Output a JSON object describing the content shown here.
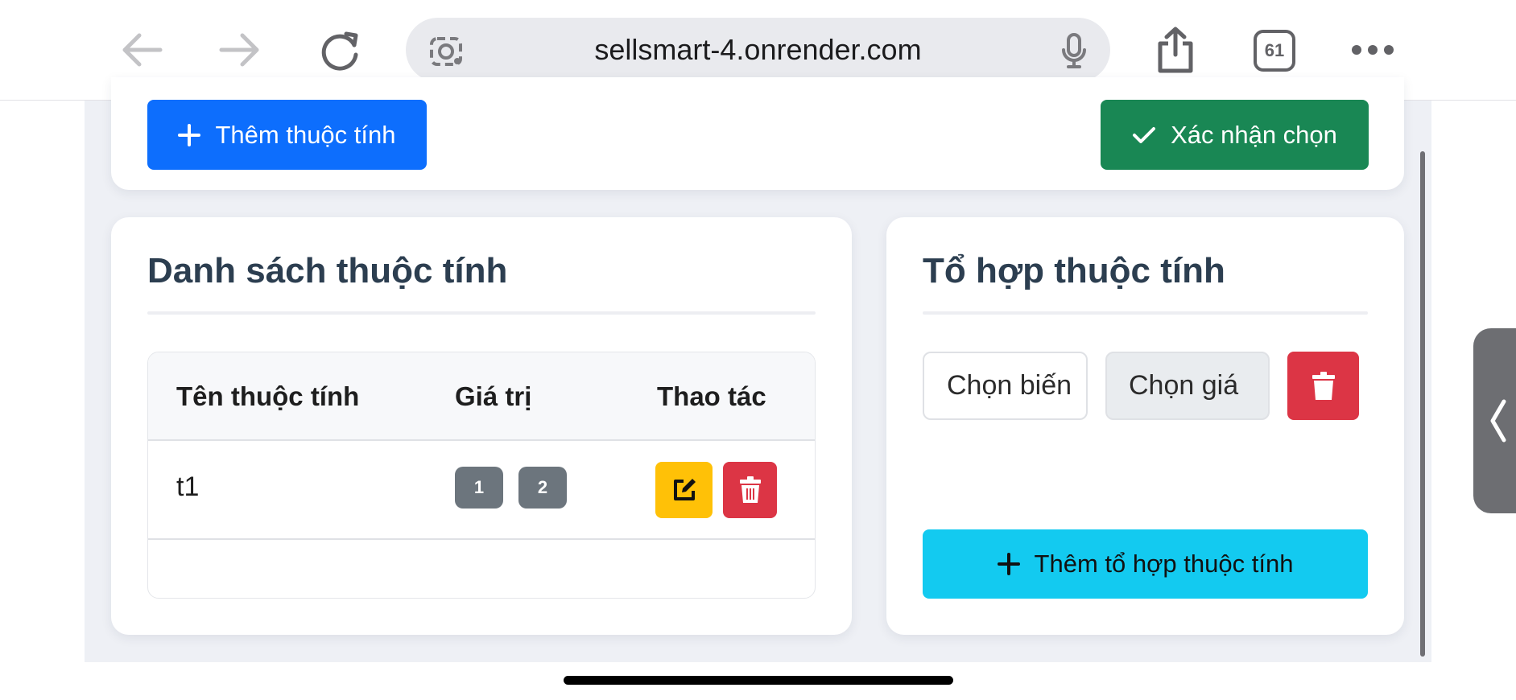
{
  "browser": {
    "url": "sellsmart-4.onrender.com",
    "tab_count": "61",
    "icons": [
      "back-arrow-icon",
      "forward-arrow-icon",
      "reload-icon",
      "lens-icon",
      "mic-icon",
      "share-icon",
      "tabs-icon",
      "more-icon"
    ]
  },
  "toolbar": {
    "add_attribute_label": "Thêm thuộc tính",
    "confirm_label": "Xác nhận chọn"
  },
  "attribute_list": {
    "title": "Danh sách thuộc tính",
    "columns": [
      "Tên thuộc tính",
      "Giá trị",
      "Thao tác"
    ],
    "rows": [
      {
        "name": "t1",
        "values": [
          "1",
          "2"
        ]
      }
    ]
  },
  "combination": {
    "title": "Tổ hợp thuộc tính",
    "variant_select": "Chọn biến",
    "value_select": "Chọn giá",
    "add_label": "Thêm tổ hợp thuộc tính"
  },
  "colors": {
    "primary": "#0d6efd",
    "success": "#198754",
    "warning": "#ffc107",
    "danger": "#dc3545",
    "info": "#13caf0",
    "secondary": "#6c757d"
  }
}
